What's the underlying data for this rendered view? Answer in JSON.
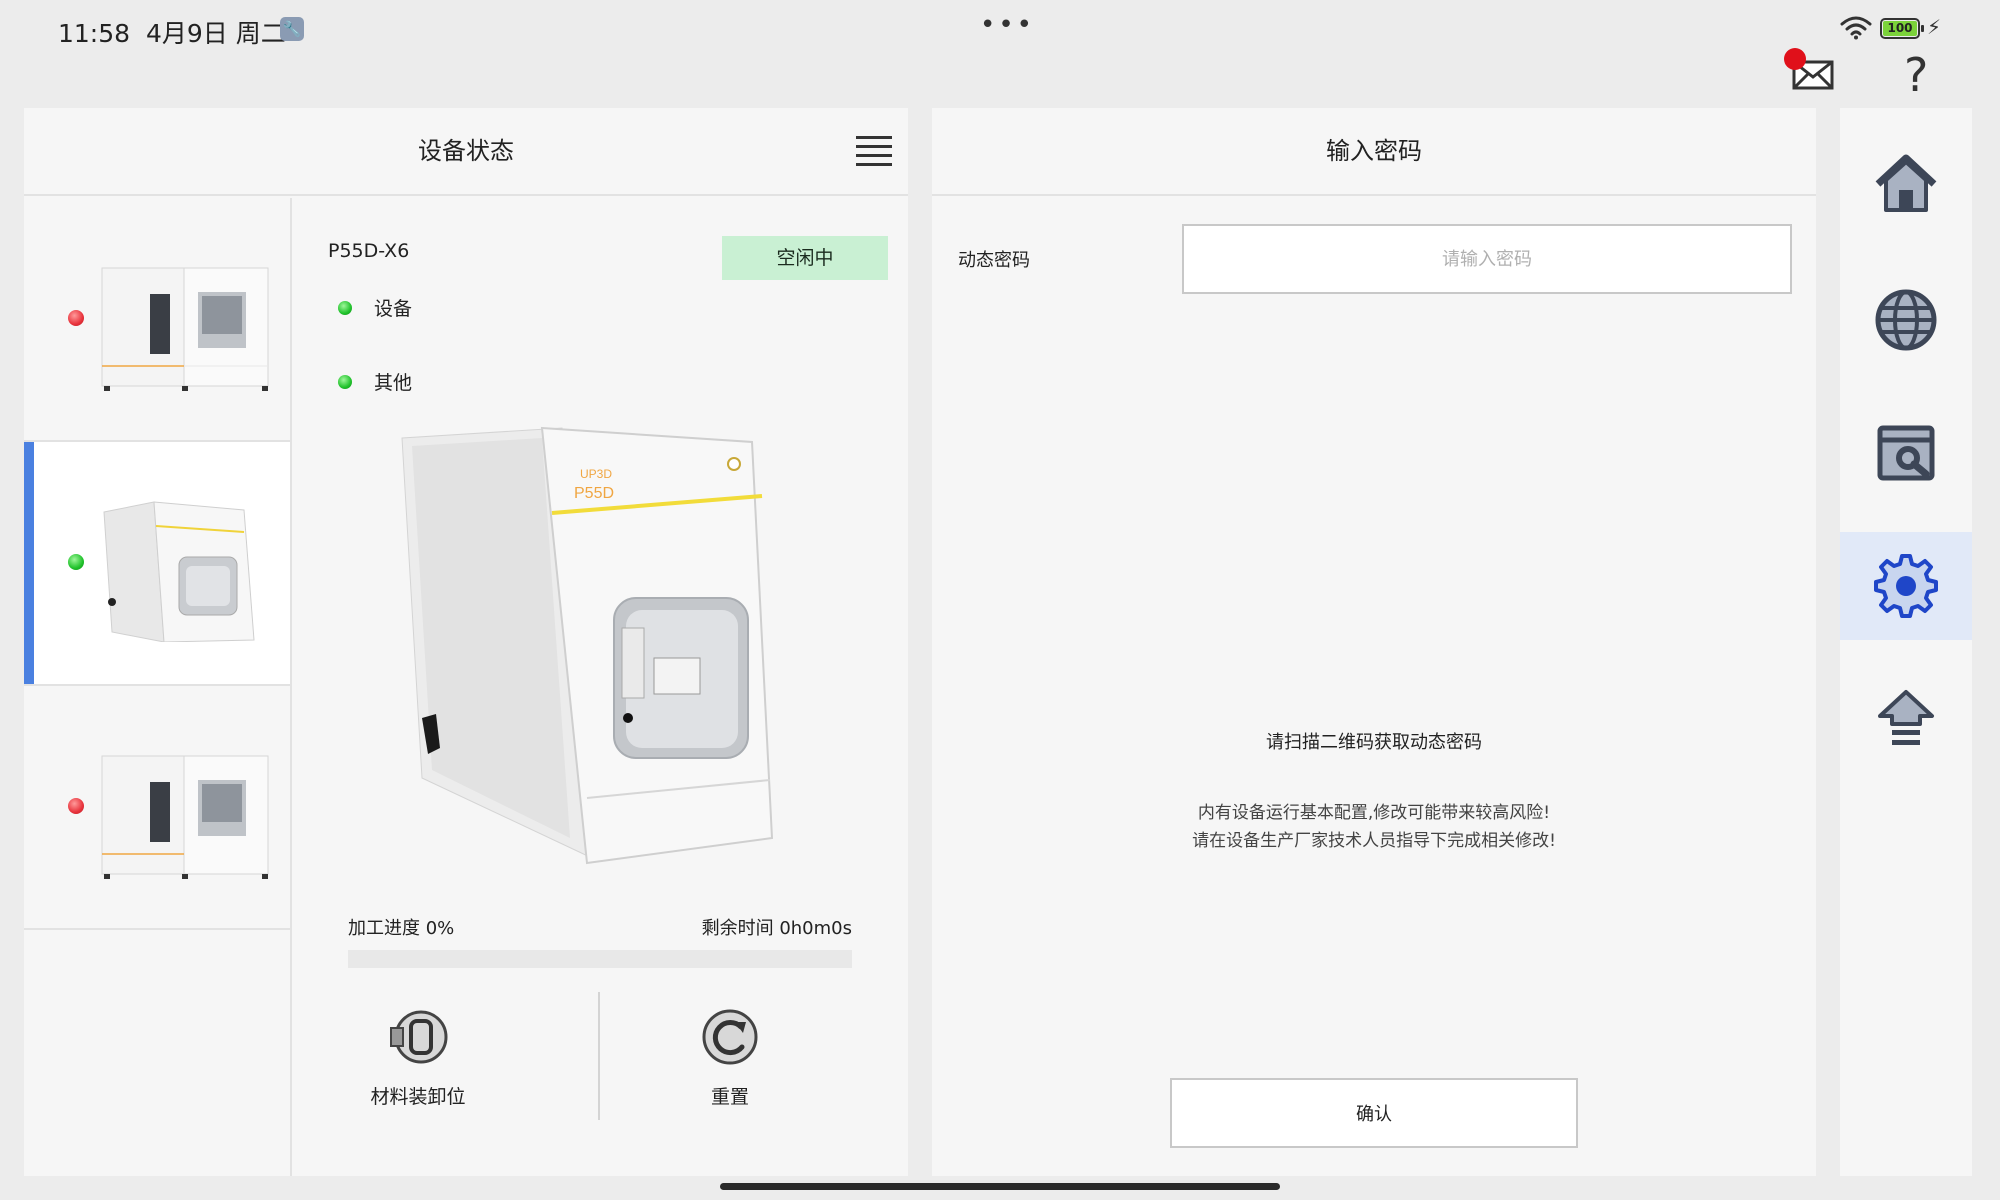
{
  "statusbar": {
    "time": "11:58",
    "date": "4月9日 周二",
    "tool_icon": "wrench-icon",
    "dots": "•••",
    "battery": "100"
  },
  "topbar": {
    "mail_icon": "mail-icon",
    "help_icon": "?"
  },
  "left_panel": {
    "title": "设备状态",
    "devices": [
      {
        "status": "red"
      },
      {
        "status": "green",
        "selected": true
      },
      {
        "status": "red"
      }
    ],
    "detail": {
      "model": "P55D-X6",
      "state": "空闲中",
      "state_color": "#c9f0d3",
      "rows": [
        {
          "label": "设备",
          "status": "green"
        },
        {
          "label": "其他",
          "status": "green"
        }
      ],
      "machine_brand": "UP3D",
      "machine_model": "P55D",
      "progress_label": "加工进度 0%",
      "progress_percent": 0,
      "remaining_label": "剩余时间 0h0m0s",
      "actions": [
        {
          "label": "材料装卸位",
          "icon": "material-load-icon"
        },
        {
          "label": "重置",
          "icon": "reset-icon"
        }
      ]
    }
  },
  "right_panel": {
    "title": "输入密码",
    "field_label": "动态密码",
    "field_value": "",
    "field_placeholder": "请输入密码",
    "qr_hint": "请扫描二维码获取动态密码",
    "warning_line1": "内有设备运行基本配置,修改可能带来较高风险!",
    "warning_line2": "请在设备生产厂家技术人员指导下完成相关修改!",
    "confirm_label": "确认"
  },
  "nav": {
    "items": [
      "home-icon",
      "globe-icon",
      "tools-window-icon",
      "settings-gear-icon",
      "upgrade-arrow-icon"
    ],
    "active_index": 3,
    "accent": "#1f46c8"
  }
}
